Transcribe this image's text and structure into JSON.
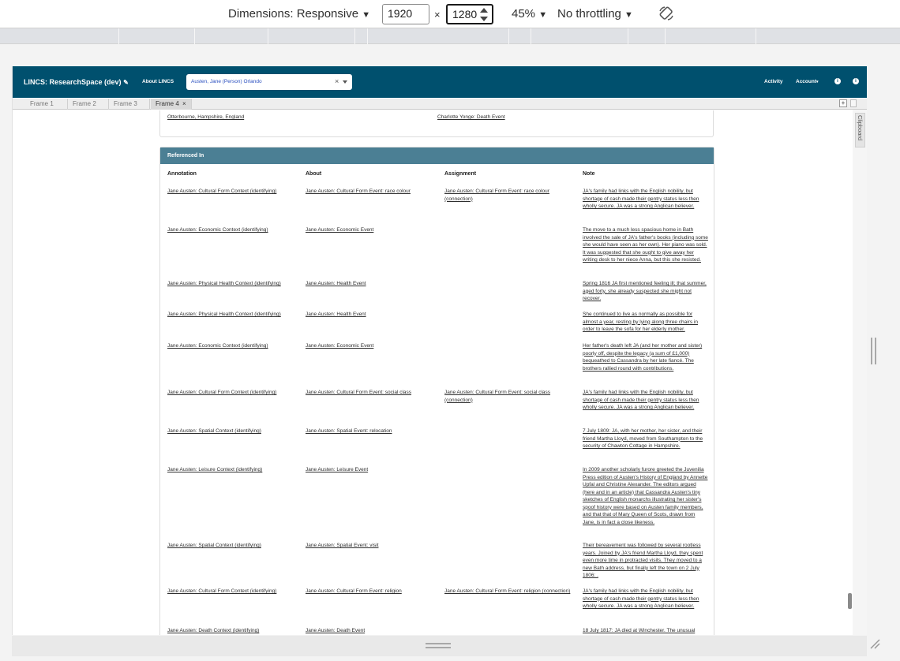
{
  "devtools": {
    "dimensions_label": "Dimensions: Responsive",
    "width_value": "1920",
    "times": "×",
    "height_value": "1280",
    "zoom": "45%",
    "throttling": "No throttling",
    "rotate_icon": "rotate-icon"
  },
  "app": {
    "brand": "LINCS: ResearchSpace (dev)",
    "edit_icon": "pencil-icon",
    "about": "About LINCS",
    "search_value": "Austen, Jane (Person) Orlando",
    "activity": "Activity",
    "account": "Account",
    "info_icon": "i"
  },
  "tabs": {
    "items": [
      "Frame 1",
      "Frame 2",
      "Frame 3",
      "Frame 4"
    ],
    "active": "Frame 4",
    "close": "×",
    "plus": "+",
    "clipboard": "Clipboard"
  },
  "previous": {
    "left_link": "Otterbourne, Hampshire, England",
    "right_link": "Charlotte Yonge: Death Event"
  },
  "referenced_in": {
    "title": "Referenced In",
    "columns": [
      "Annotation",
      "About",
      "Assignment",
      "Note"
    ],
    "rows": [
      {
        "annotation": "Jane Austen: Cultural Form Context (identifying)",
        "about": "Jane Austen: Cultural Form Event: race colour",
        "assignment": "Jane Austen: Cultural Form Event: race colour (connection)",
        "note": "JA's family had links with the English nobility, but shortage of cash made their gentry status less then wholly secure. JA was a strong Anglican believer."
      },
      {
        "annotation": "Jane Austen: Economic Context (identifying)",
        "about": "Jane Austen: Economic Event",
        "assignment": "",
        "note": "The move to a much less spacious home in Bath involved the sale of JA's father's books (including some she would have seen as her own). Her piano was sold. It was suggested that she ought to give away her writing desk to her niece Anna, but this she resisted."
      },
      {
        "annotation": "Jane Austen: Physical Health Context (identifying)",
        "about": "Jane Austen: Health Event",
        "assignment": "",
        "note": "Spring 1816 JA first mentioned feeling ill; that summer, aged forty, she already suspected she might not recover."
      },
      {
        "annotation": "Jane Austen: Physical Health Context (identifying)",
        "about": "Jane Austen: Health Event",
        "assignment": "",
        "note": "She continued to live as normally as possible for almost a year, resting by lying along three chairs in order to leave the sofa for her elderly mother."
      },
      {
        "annotation": "Jane Austen: Economic Context (identifying)",
        "about": "Jane Austen: Economic Event",
        "assignment": "",
        "note": "Her father's death left JA (and her mother and sister) poorly off, despite the legacy (a sum of £1,000) bequeathed to Cassandra by her late fiancé. The brothers rallied round with contributions."
      },
      {
        "annotation": "Jane Austen: Cultural Form Context (identifying)",
        "about": "Jane Austen: Cultural Form Event: social class",
        "assignment": "Jane Austen: Cultural Form Event: social class (connection)",
        "note": "JA's family had links with the English nobility, but shortage of cash made their gentry status less then wholly secure. JA was a strong Anglican believer."
      },
      {
        "annotation": "Jane Austen: Spatial Context (identifying)",
        "about": "Jane Austen: Spatial Event: relocation",
        "assignment": "",
        "note": "7 July 1809: JA, with her mother, her sister, and their friend Martha Lloyd, moved from Southampton to the security of Chawton Cottage in Hampshire."
      },
      {
        "annotation": "Jane Austen: Leisure Context (identifying)",
        "about": "Jane Austen: Leisure Event",
        "assignment": "",
        "note": "In 2009 another scholarly furore greeted the Juvenilia Press edition of Austen's History of England by Annette Upfal and Christine Alexander. The editors argued (here and in an article) that Cassandra Austen's tiny sketches of English monarchs illustrating her sister's spoof history were based on Austen family members, and that that of Mary Queen of Scots, drawn from Jane, is in fact a close likeness."
      },
      {
        "annotation": "Jane Austen: Spatial Context (identifying)",
        "about": "Jane Austen: Spatial Event: visit",
        "assignment": "",
        "note": "Their bereavement was followed by several rootless years. Joined by JA's friend Martha Lloyd, they spent even more time in protracted visits. They moved to a new Bath address, but finally left the town on 2 July 1806: ."
      },
      {
        "annotation": "Jane Austen: Cultural Form Context (identifying)",
        "about": "Jane Austen: Cultural Form Event: religion",
        "assignment": "Jane Austen: Cultural Form Event: religion (connection)",
        "note": "JA's family had links with the English nobility, but shortage of cash made their gentry status less then wholly secure. JA was a strong Anglican believer."
      },
      {
        "annotation": "Jane Austen: Death Context (identifying)",
        "about": "Jane Austen: Death Event",
        "assignment": "",
        "note": "18 July 1817: JA died at Winchester. The unusual"
      }
    ]
  }
}
